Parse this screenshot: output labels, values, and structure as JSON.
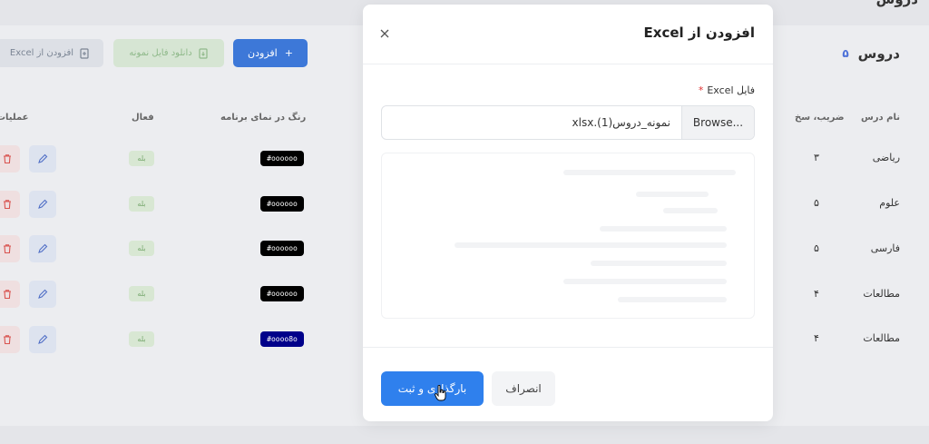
{
  "page": {
    "title": "دروس"
  },
  "card": {
    "title": "دروس",
    "count": "۵",
    "add_button": "افزودن",
    "download_sample_button": "دانلود فایل نمونه",
    "import_excel_button": "افزودن از Excel"
  },
  "table": {
    "headers": {
      "name": "نام درس",
      "coefficient": "ضریب، سخ",
      "color": "رنگ در نمای برنامه",
      "active": "فعال",
      "actions": "عملیات"
    },
    "rows": [
      {
        "name": "ریاضی",
        "coefficient": "۳",
        "color": "#000000",
        "color_label": "#oooooo",
        "active": "بله"
      },
      {
        "name": "علوم",
        "coefficient": "۵",
        "color": "#000000",
        "color_label": "#oooooo",
        "active": "بله"
      },
      {
        "name": "فارسی",
        "coefficient": "۵",
        "color": "#000000",
        "color_label": "#oooooo",
        "active": "بله"
      },
      {
        "name": "مطالعات",
        "coefficient": "۴",
        "color": "#000000",
        "color_label": "#oooooo",
        "active": "بله"
      },
      {
        "name": "مطالعات",
        "coefficient": "۴",
        "color": "#00008a",
        "color_label": "#oooo8o",
        "active": "بله"
      }
    ]
  },
  "modal": {
    "title": "افزودن از Excel",
    "field_label": "فایل Excel",
    "required_mark": "*",
    "browse_label": "Browse...",
    "file_name": "نمونه_دروس(1).xlsx",
    "submit_button": "بارگذاری و ثبت",
    "cancel_button": "انصراف"
  },
  "colors": {
    "primary": "#2f80ed",
    "add_button": "#3d78d8",
    "required": "#e03131",
    "overlay": "#e4e5e9"
  }
}
